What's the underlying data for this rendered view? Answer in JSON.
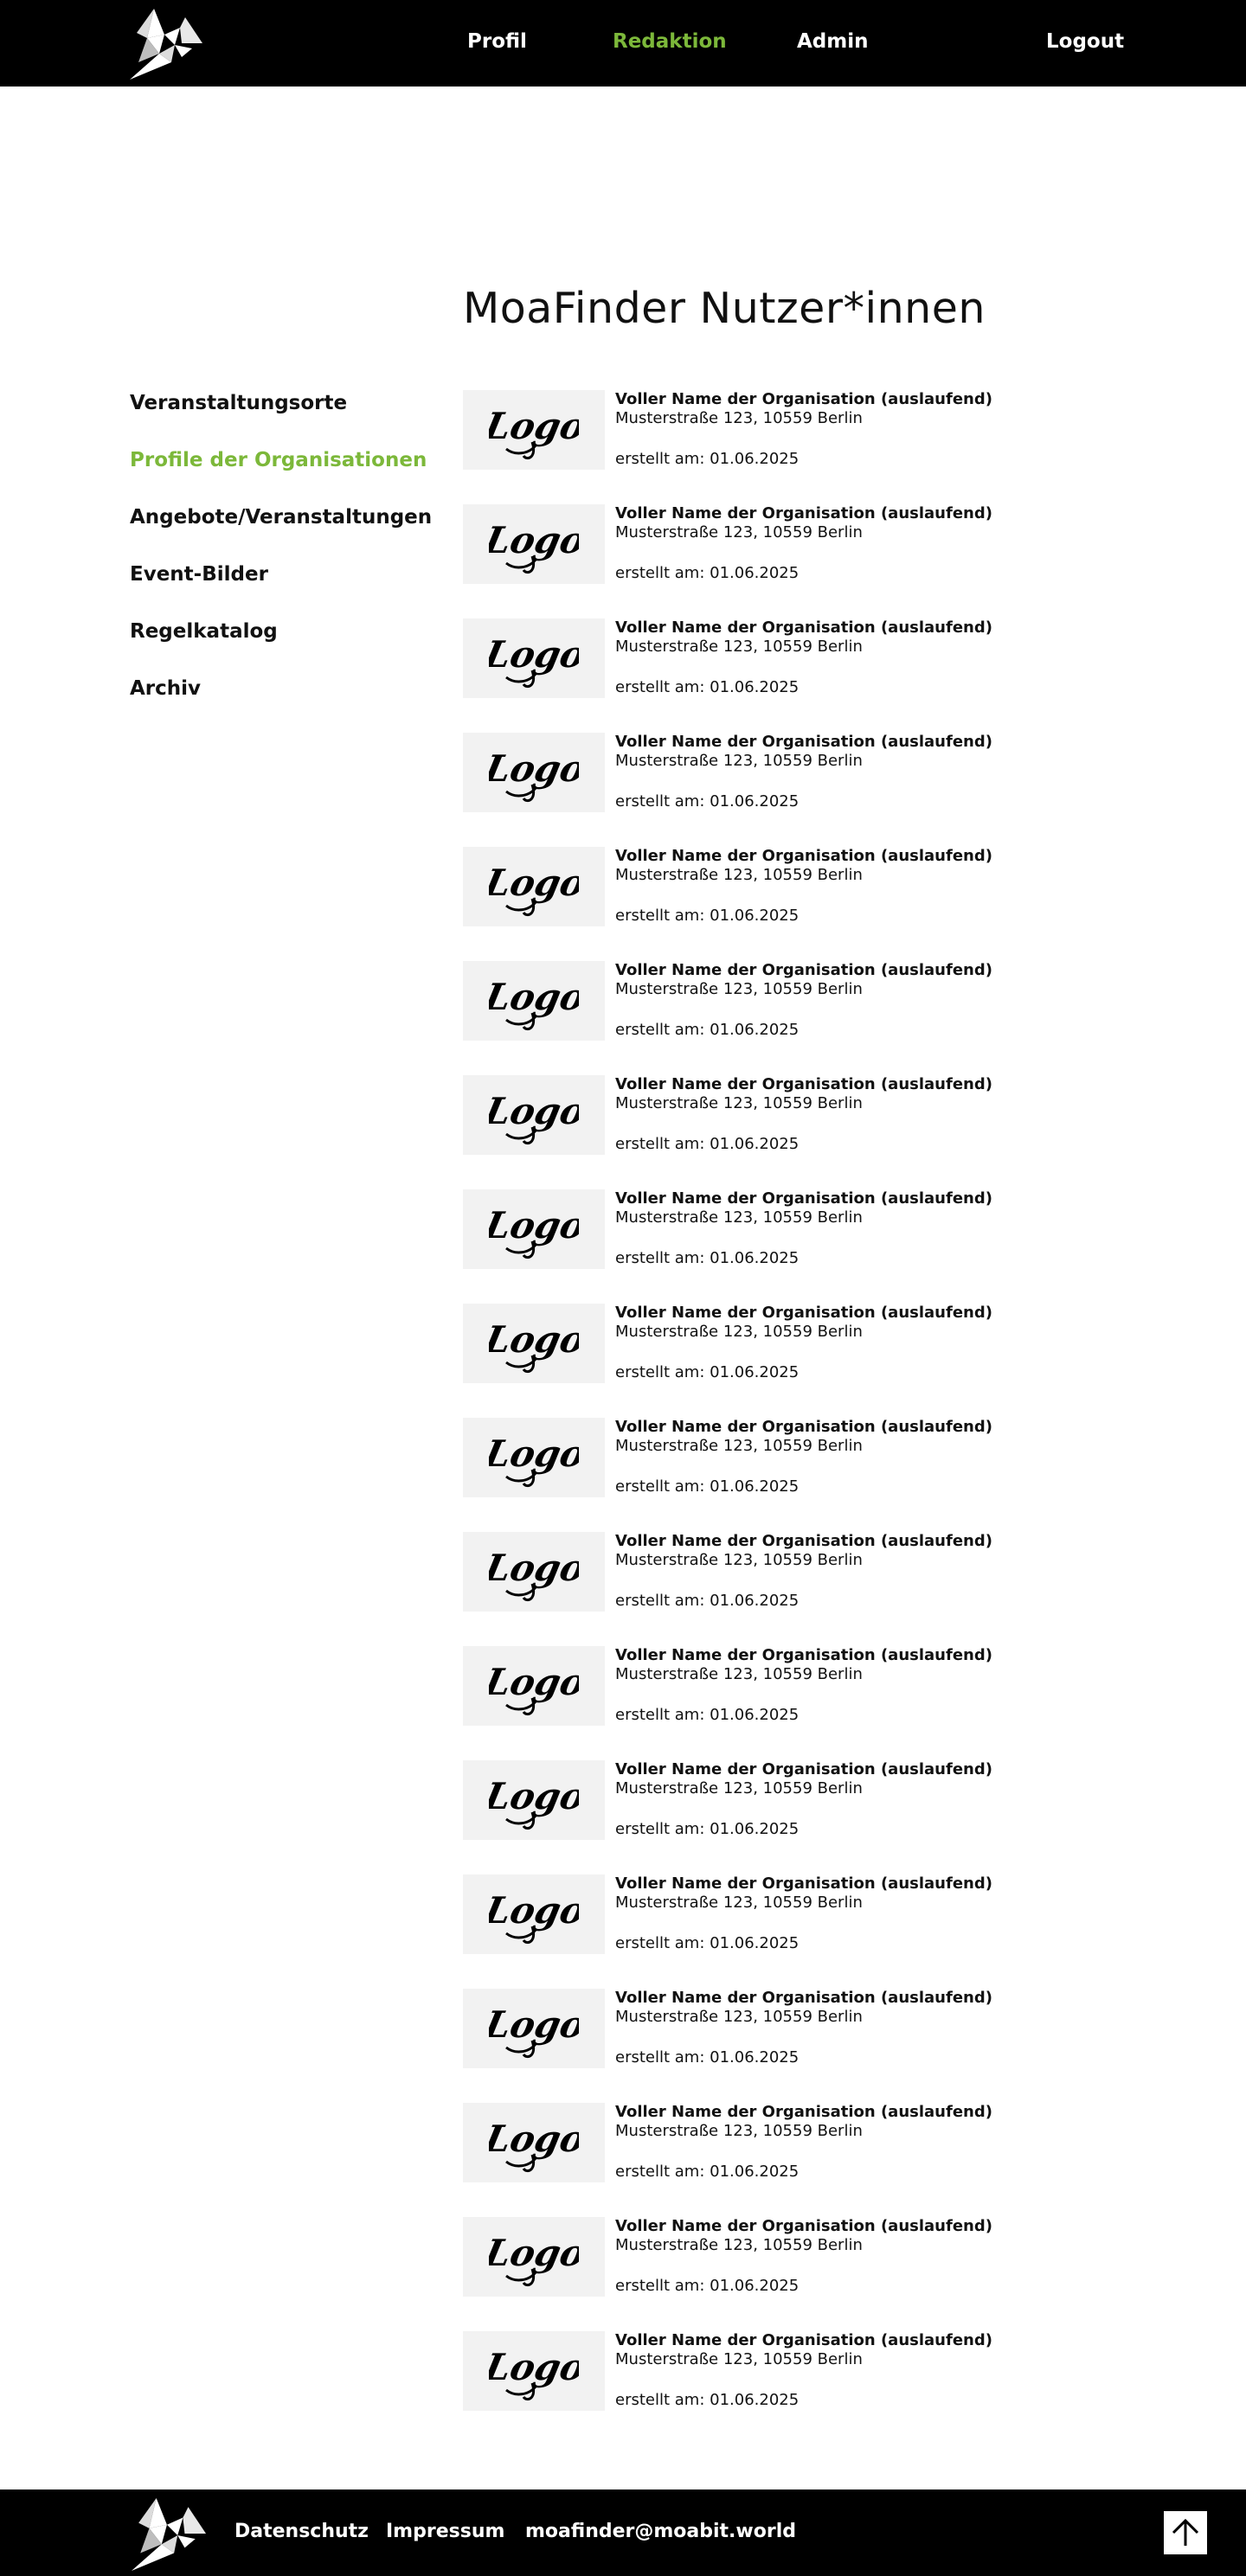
{
  "header": {
    "logo_icon": "origami-bird-logo",
    "nav": {
      "profil": "Profil",
      "redaktion": "Redaktion",
      "admin": "Admin",
      "logout": "Logout"
    },
    "active_item": "Redaktion"
  },
  "page": {
    "title": "MoaFinder Nutzer*innen"
  },
  "sidebar": {
    "items": [
      {
        "label": "Veranstaltungsorte"
      },
      {
        "label": "Profile  der Organisationen"
      },
      {
        "label": "Angebote/Veranstaltungen"
      },
      {
        "label": "Event-Bilder"
      },
      {
        "label": "Regelkatalog"
      },
      {
        "label": "Archiv"
      }
    ],
    "active_item": "Profile  der Organisationen"
  },
  "organizations": [
    {
      "logo_text": "Logo",
      "name": "Voller Name der Organisation (auslaufend)",
      "address": "Musterstraße 123, 10559 Berlin",
      "created": "erstellt am: 01.06.2025"
    },
    {
      "logo_text": "Logo",
      "name": "Voller Name der Organisation (auslaufend)",
      "address": "Musterstraße 123, 10559 Berlin",
      "created": "erstellt am: 01.06.2025"
    },
    {
      "logo_text": "Logo",
      "name": "Voller Name der Organisation (auslaufend)",
      "address": "Musterstraße 123, 10559 Berlin",
      "created": "erstellt am: 01.06.2025"
    },
    {
      "logo_text": "Logo",
      "name": "Voller Name der Organisation (auslaufend)",
      "address": "Musterstraße 123, 10559 Berlin",
      "created": "erstellt am: 01.06.2025"
    },
    {
      "logo_text": "Logo",
      "name": "Voller Name der Organisation (auslaufend)",
      "address": "Musterstraße 123, 10559 Berlin",
      "created": "erstellt am: 01.06.2025"
    },
    {
      "logo_text": "Logo",
      "name": "Voller Name der Organisation (auslaufend)",
      "address": "Musterstraße 123, 10559 Berlin",
      "created": "erstellt am: 01.06.2025"
    },
    {
      "logo_text": "Logo",
      "name": "Voller Name der Organisation (auslaufend)",
      "address": "Musterstraße 123, 10559 Berlin",
      "created": "erstellt am: 01.06.2025"
    },
    {
      "logo_text": "Logo",
      "name": "Voller Name der Organisation (auslaufend)",
      "address": "Musterstraße 123, 10559 Berlin",
      "created": "erstellt am: 01.06.2025"
    },
    {
      "logo_text": "Logo",
      "name": "Voller Name der Organisation (auslaufend)",
      "address": "Musterstraße 123, 10559 Berlin",
      "created": "erstellt am: 01.06.2025"
    },
    {
      "logo_text": "Logo",
      "name": "Voller Name der Organisation (auslaufend)",
      "address": "Musterstraße 123, 10559 Berlin",
      "created": "erstellt am: 01.06.2025"
    },
    {
      "logo_text": "Logo",
      "name": "Voller Name der Organisation (auslaufend)",
      "address": "Musterstraße 123, 10559 Berlin",
      "created": "erstellt am: 01.06.2025"
    },
    {
      "logo_text": "Logo",
      "name": "Voller Name der Organisation (auslaufend)",
      "address": "Musterstraße 123, 10559 Berlin",
      "created": "erstellt am: 01.06.2025"
    },
    {
      "logo_text": "Logo",
      "name": "Voller Name der Organisation (auslaufend)",
      "address": "Musterstraße 123, 10559 Berlin",
      "created": "erstellt am: 01.06.2025"
    },
    {
      "logo_text": "Logo",
      "name": "Voller Name der Organisation (auslaufend)",
      "address": "Musterstraße 123, 10559 Berlin",
      "created": "erstellt am: 01.06.2025"
    },
    {
      "logo_text": "Logo",
      "name": "Voller Name der Organisation (auslaufend)",
      "address": "Musterstraße 123, 10559 Berlin",
      "created": "erstellt am: 01.06.2025"
    },
    {
      "logo_text": "Logo",
      "name": "Voller Name der Organisation (auslaufend)",
      "address": "Musterstraße 123, 10559 Berlin",
      "created": "erstellt am: 01.06.2025"
    },
    {
      "logo_text": "Logo",
      "name": "Voller Name der Organisation (auslaufend)",
      "address": "Musterstraße 123, 10559 Berlin",
      "created": "erstellt am: 01.06.2025"
    },
    {
      "logo_text": "Logo",
      "name": "Voller Name der Organisation (auslaufend)",
      "address": "Musterstraße 123, 10559 Berlin",
      "created": "erstellt am: 01.06.2025"
    }
  ],
  "footer": {
    "logo_icon": "origami-bird-logo",
    "links": {
      "datenschutz": "Datenschutz",
      "impressum": "Impressum",
      "email": "moafinder@moabit.world"
    },
    "to_top_icon": "arrow-up-icon"
  },
  "colors": {
    "accent": "#7cb83a",
    "bar_background": "#000000",
    "logo_placeholder": "#f2f2f2"
  }
}
